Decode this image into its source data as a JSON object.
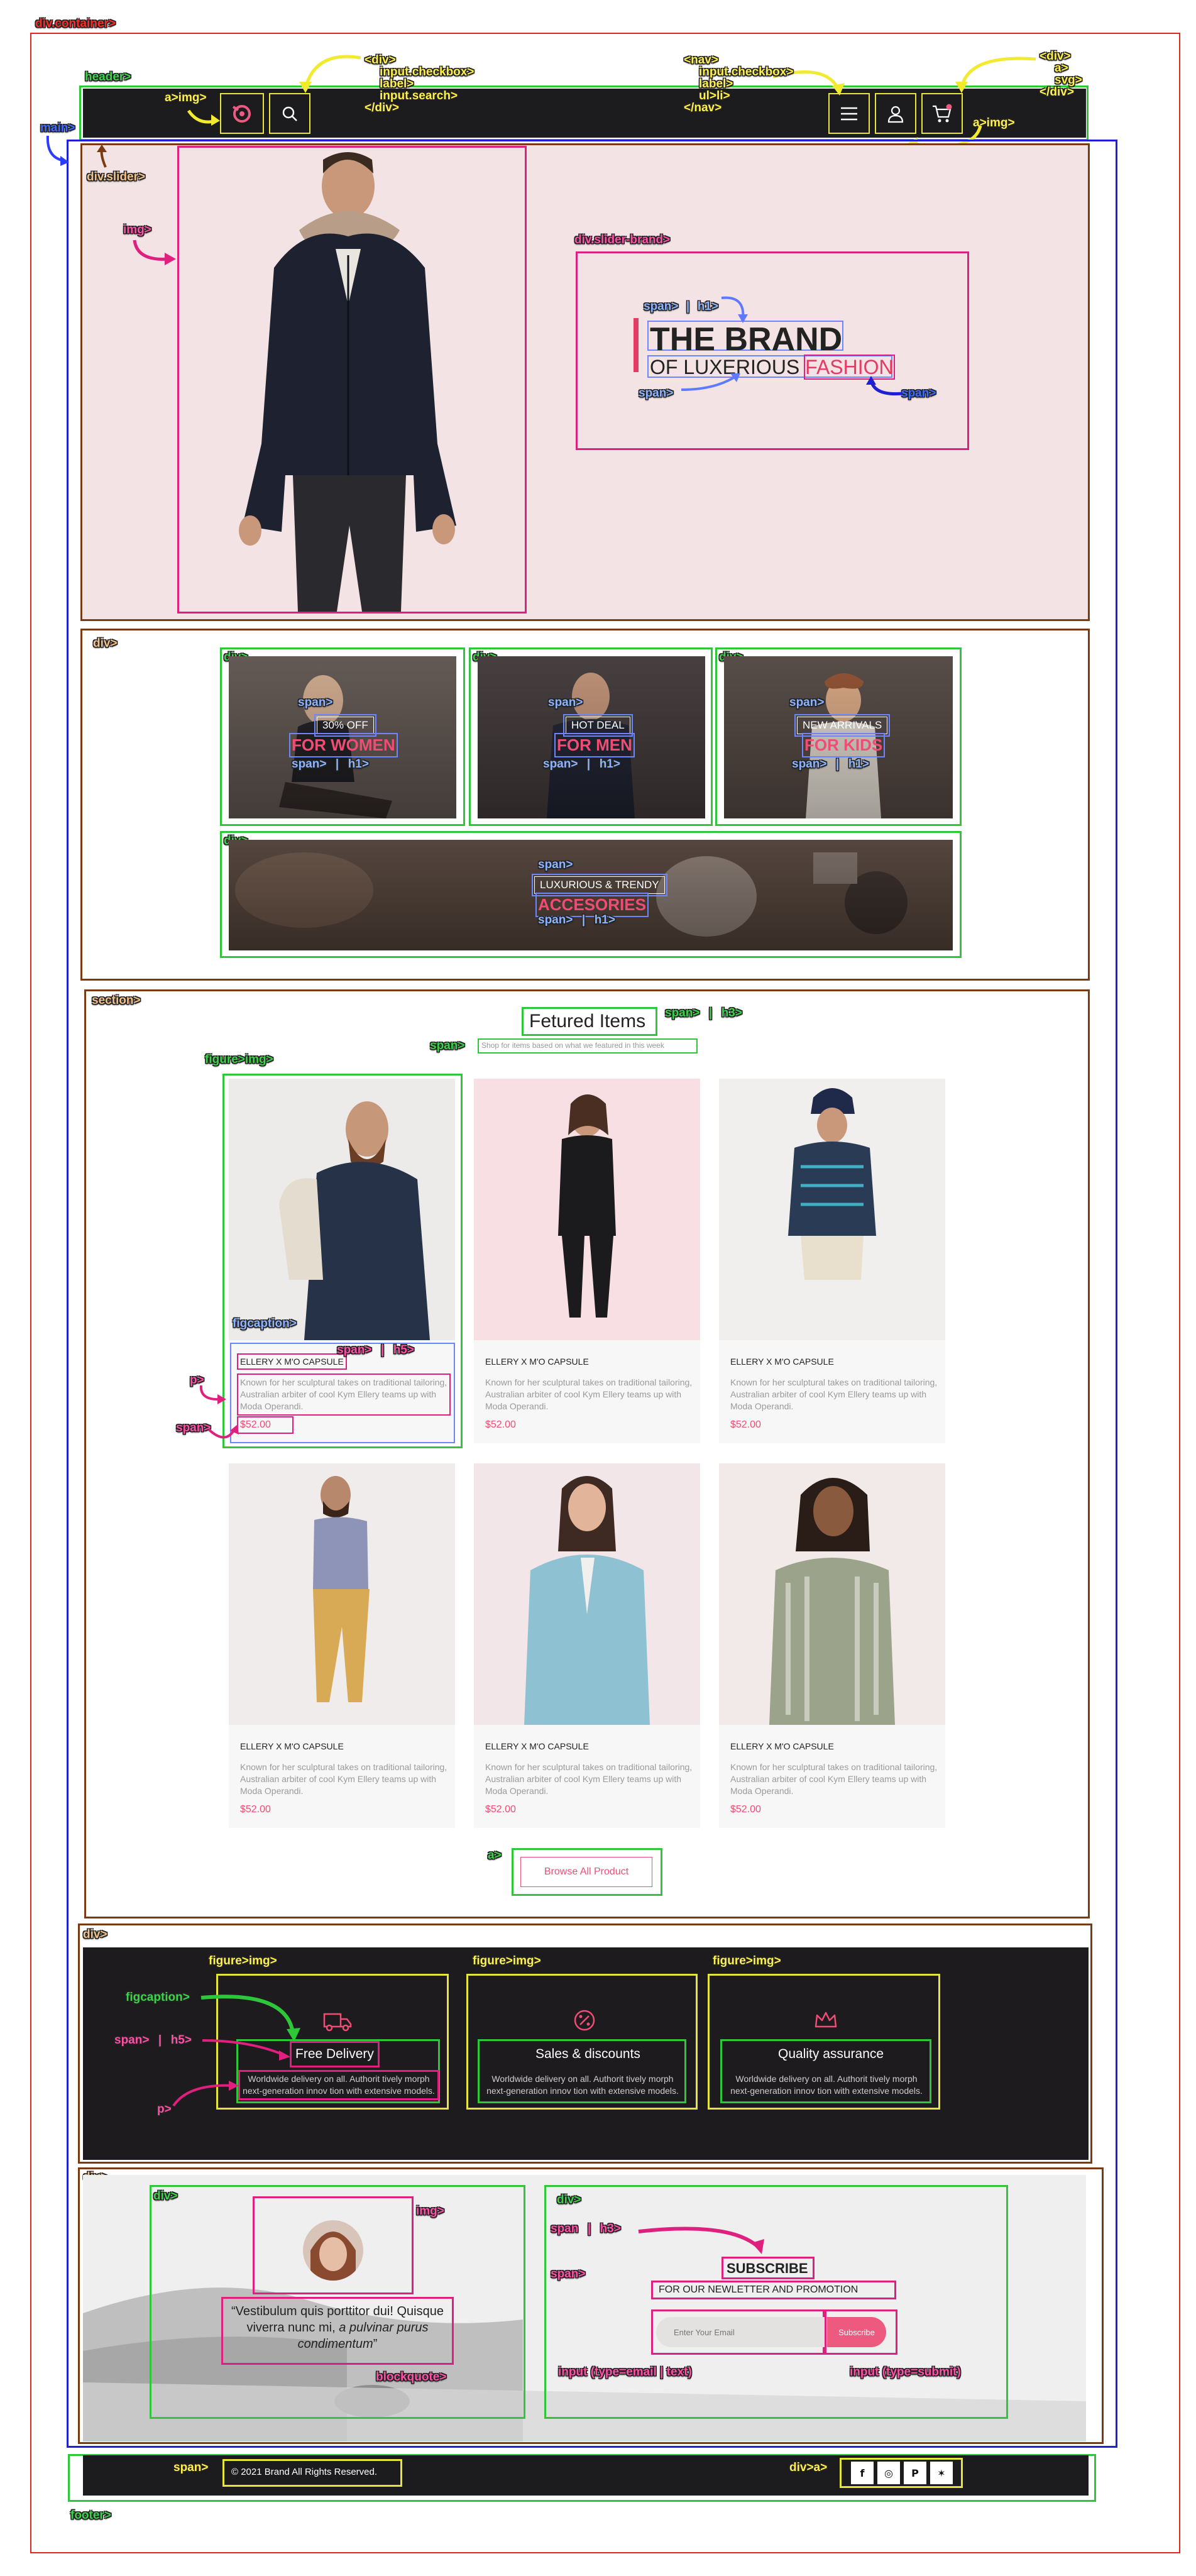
{
  "annotations": {
    "container": "div.container>",
    "header": "header>",
    "main": "main>",
    "a_img_left": "a>img>",
    "div_checkbox_left": [
      "<div>",
      "input.checkbox>",
      "label>",
      "input.search>",
      "</div>"
    ],
    "nav_block": [
      "<nav>",
      "input.checkbox>",
      "label>",
      "ul>li>",
      "</nav>"
    ],
    "div_right": [
      "<div>",
      "a>",
      "svg>",
      "</div>"
    ],
    "a_img_right": "a>img>",
    "div_slider": "div.slider>",
    "img": "img>",
    "div_slider_brand": "div.slider-brand>",
    "span": "span>",
    "bar": "|",
    "h1": "h1>",
    "div": "div>",
    "section": "section>",
    "h3": "h3>",
    "h5": "h5>",
    "p": "p>",
    "figure_img": "figure>img>",
    "figcaption": "figcaption>",
    "a": "a>",
    "span_bare": "span",
    "blockquote": "blockquote>",
    "input_email": "input (type=email | text)",
    "input_submit": "input (type=submit)",
    "div_a": "div>a>",
    "footer": "footer>"
  },
  "slider": {
    "brand_title": "THE BRAND",
    "brand_sub_prefix": "OF LUXERIOUS",
    "brand_sub_highlight": "FASHION"
  },
  "categories": [
    {
      "small": "30% OFF",
      "big": "FOR WOMEN"
    },
    {
      "small": "HOT DEAL",
      "big": "FOR MEN"
    },
    {
      "small": "NEW ARRIVALS",
      "big": "FOR KIDS"
    },
    {
      "small": "LUXURIOUS & TRENDY",
      "big": "ACCESORIES"
    }
  ],
  "featured": {
    "title": "Fetured Items",
    "subtitle": "Shop for items based on what we featured in this week",
    "browse_label": "Browse All Product"
  },
  "products": [
    {
      "title": "ELLERY X M'O CAPSULE",
      "desc": "Known for her sculptural takes on traditional tailoring, Australian arbiter of cool Kym Ellery teams up with Moda Operandi.",
      "price": "$52.00"
    },
    {
      "title": "ELLERY X M'O CAPSULE",
      "desc": "Known for her sculptural takes on traditional tailoring, Australian arbiter of cool Kym Ellery teams up with Moda Operandi.",
      "price": "$52.00"
    },
    {
      "title": "ELLERY X M'O CAPSULE",
      "desc": "Known for her sculptural takes on traditional tailoring, Australian arbiter of cool Kym Ellery teams up with Moda Operandi.",
      "price": "$52.00"
    },
    {
      "title": "ELLERY X M'O CAPSULE",
      "desc": "Known for her sculptural takes on traditional tailoring, Australian arbiter of cool Kym Ellery teams up with Moda Operandi.",
      "price": "$52.00"
    },
    {
      "title": "ELLERY X M'O CAPSULE",
      "desc": "Known for her sculptural takes on traditional tailoring, Australian arbiter of cool Kym Ellery teams up with Moda Operandi.",
      "price": "$52.00"
    },
    {
      "title": "ELLERY X M'O CAPSULE",
      "desc": "Known for her sculptural takes on traditional tailoring, Australian arbiter of cool Kym Ellery teams up with Moda Operandi.",
      "price": "$52.00"
    }
  ],
  "features": [
    {
      "icon": "truck-icon",
      "title": "Free Delivery",
      "desc": "Worldwide delivery on all. Authorit tively morph next-generation innov tion with extensive models."
    },
    {
      "icon": "percent-icon",
      "title": "Sales & discounts",
      "desc": "Worldwide delivery on all. Authorit tively morph next-generation innov tion with extensive models."
    },
    {
      "icon": "crown-icon",
      "title": "Quality assurance",
      "desc": "Worldwide delivery on all. Authorit tively morph next-generation innov tion with extensive models."
    }
  ],
  "testimonial": {
    "quote_start": "“Vestibulum quis porttitor dui! Quisque viverra nunc mi,",
    "quote_em": "a pulvinar purus condimentum",
    "quote_end": "”"
  },
  "subscribe": {
    "title": "SUBSCRIBE",
    "subtitle": "FOR OUR NEWLETTER AND PROMOTION",
    "email_placeholder": "Enter Your Email",
    "submit_label": "Subscribe"
  },
  "footer": {
    "copyright": "© 2021  Brand  All Rights Reserved.",
    "social": [
      "f",
      "◎",
      "P",
      "✶"
    ]
  },
  "colors": {
    "accent": "#ee4d74",
    "dark": "#1c1c1f",
    "slider_bg": "#f3e3e4",
    "outline_red": "#e0261f",
    "outline_blue": "#1f1fd6",
    "outline_green": "#2ec73a",
    "outline_brown": "#7a3a12",
    "outline_yellow": "#e6e63a",
    "outline_magenta": "#e0207f"
  }
}
